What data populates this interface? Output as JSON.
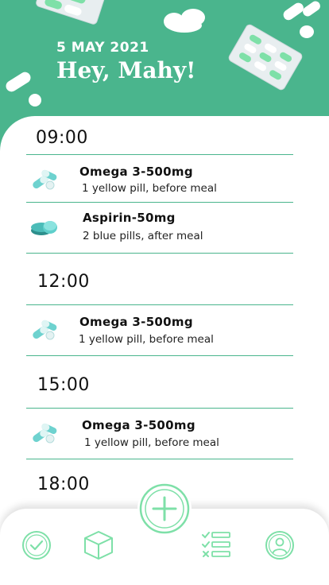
{
  "header": {
    "date": "5 MAY 2021",
    "greeting": "Hey, Mahy!"
  },
  "colors": {
    "accent": "#4ab58d",
    "icon_teal": "#6ed2cf",
    "icon_green": "#7ee0a8"
  },
  "schedule": [
    {
      "time": "09:00",
      "meds": [
        {
          "name": "Omega 3-500mg",
          "desc": "1 yellow pill, before meal",
          "icon": "capsule-pills-icon"
        },
        {
          "name": "Aspirin-50mg",
          "desc": "2 blue pills, after meal",
          "icon": "tablet-pills-icon"
        }
      ]
    },
    {
      "time": "12:00",
      "meds": [
        {
          "name": "Omega 3-500mg",
          "desc": "1 yellow pill, before meal",
          "icon": "capsule-pills-icon"
        }
      ]
    },
    {
      "time": "15:00",
      "meds": [
        {
          "name": "Omega 3-500mg",
          "desc": "1 yellow pill, before meal",
          "icon": "capsule-pills-icon"
        }
      ]
    },
    {
      "time": "18:00",
      "meds": []
    }
  ],
  "nav": {
    "items": [
      "check-icon",
      "box-icon",
      "add-icon",
      "checklist-icon",
      "profile-icon"
    ]
  }
}
